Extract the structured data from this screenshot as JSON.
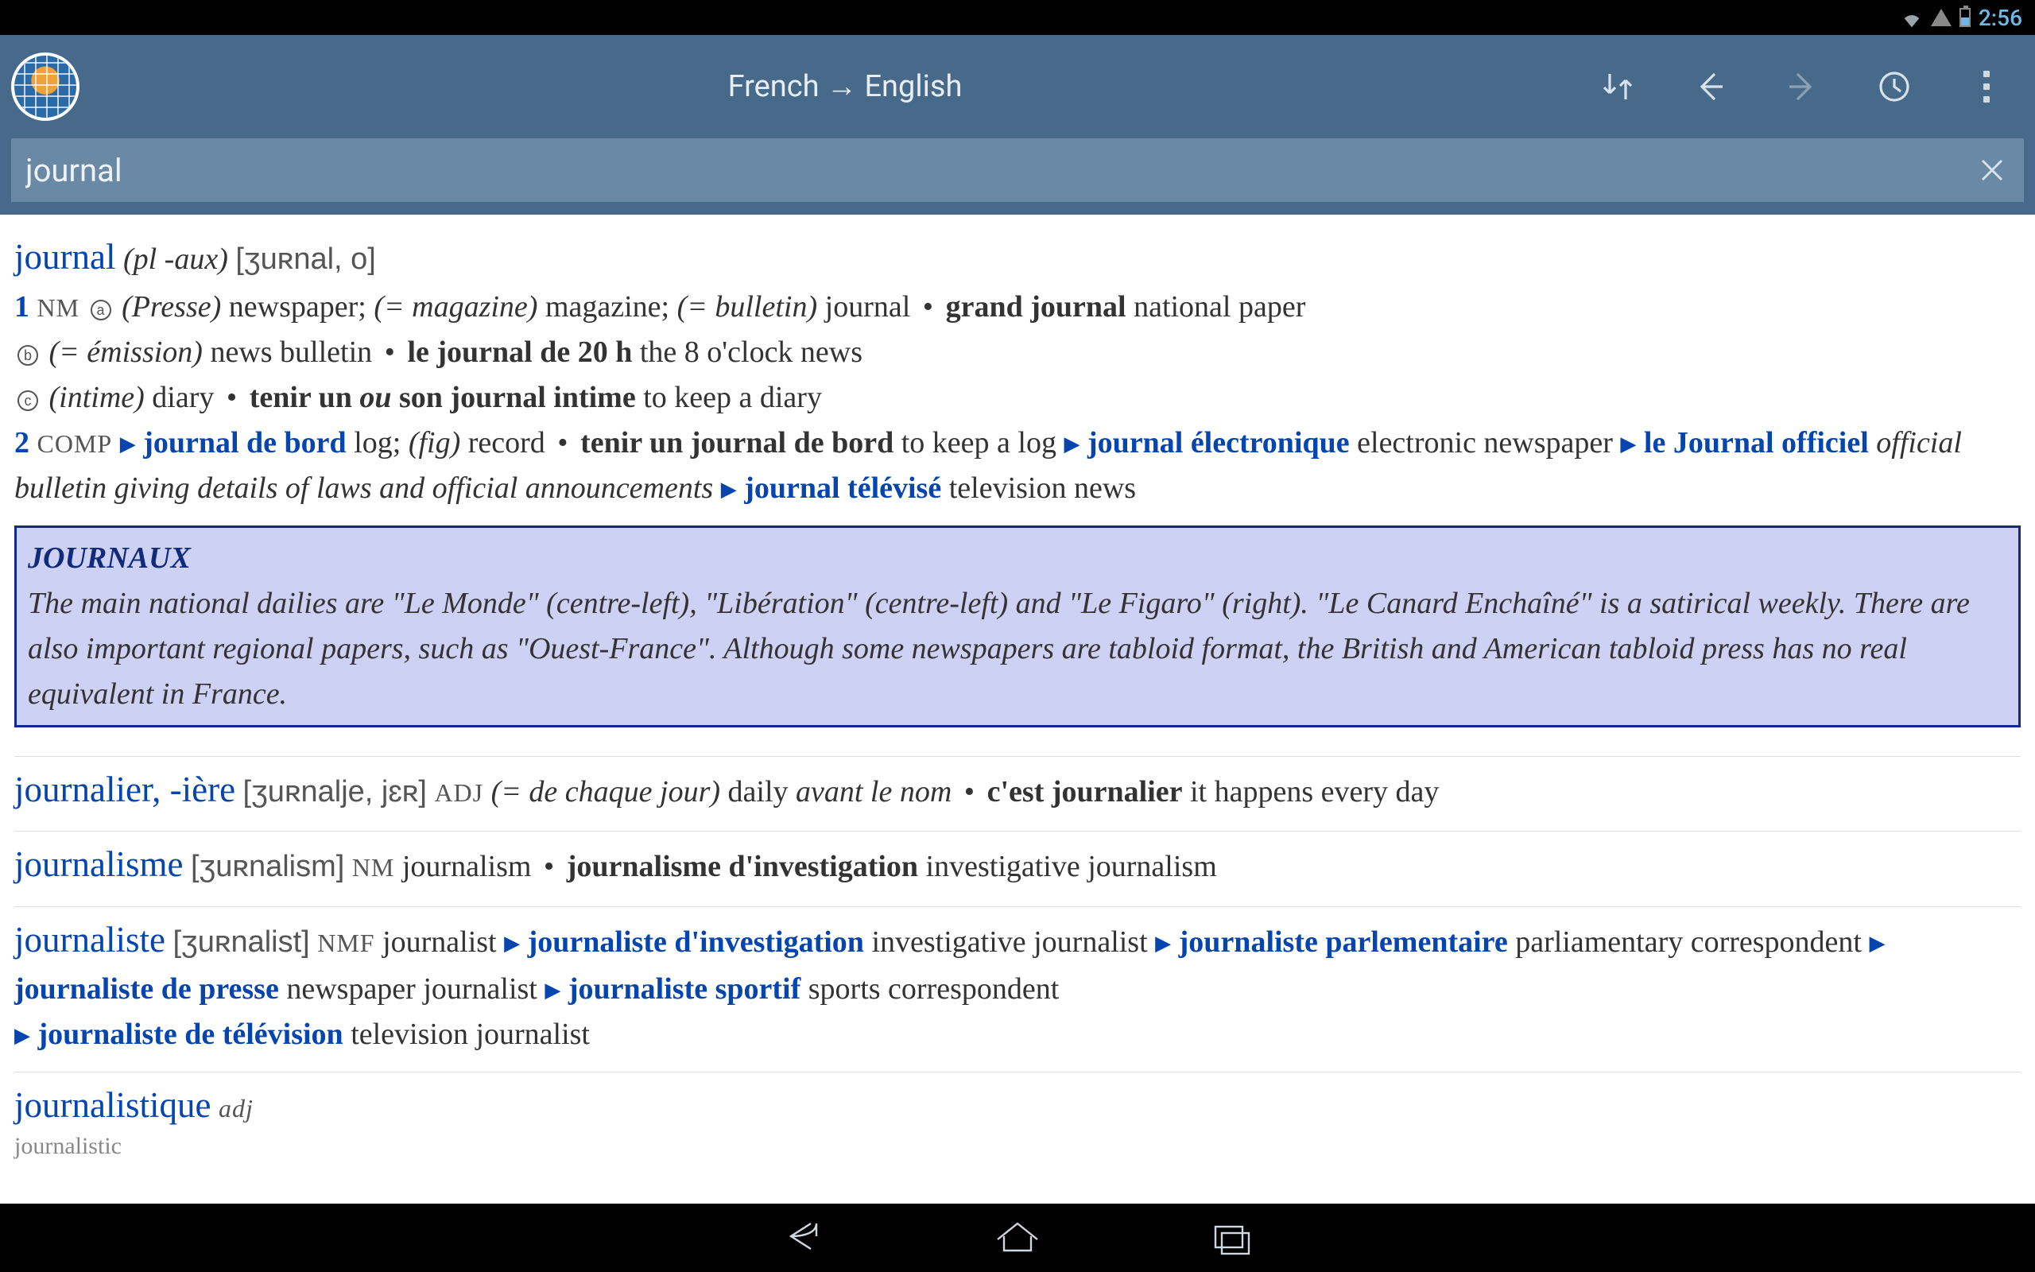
{
  "status": {
    "time": "2:56"
  },
  "header": {
    "title": "French  →  English"
  },
  "search": {
    "value": "journal"
  },
  "entries": {
    "journal": {
      "hw": "journal",
      "inflect": "(pl -aux)",
      "ipa": "[ʒuʀnal, o]",
      "sense1_num": "1",
      "sense1_pos": "NM",
      "s1a_ctx": "(Presse)",
      "s1a_tr": "newspaper; ",
      "s1a_eqmag": "(= magazine)",
      "s1a_mag": " magazine; ",
      "s1a_eqbull": "(= bulletin)",
      "s1a_journal": " journal ",
      "s1a_grand_fr": "grand journal",
      "s1a_grand_en": " national paper",
      "s1b_ctx": "(= émission)",
      "s1b_tr": " news bulletin ",
      "s1b_20h_fr": "le journal de 20 h",
      "s1b_20h_en": " the 8 o'clock news",
      "s1c_ctx": "(intime)",
      "s1c_tr": " diary ",
      "s1c_tenir_prefix": "tenir un ",
      "s1c_tenir_ou": "ou",
      "s1c_tenir_suffix": " son journal intime",
      "s1c_tenir_en": " to keep a diary",
      "sense2_num": "2",
      "sense2_pos": "COMP",
      "s2_bord_fr": "journal de bord",
      "s2_bord_en": " log; ",
      "s2_fig": "(fig)",
      "s2_record": " record ",
      "s2_tenir_fr": "tenir un journal de bord",
      "s2_tenir_en": " to keep a log ",
      "s2_elec_fr": "journal électronique",
      "s2_elec_en": " electronic newspaper ",
      "s2_jo_fr": "le Journal officiel",
      "s2_jo_en": " official bulletin giving details of laws and official announcements ",
      "s2_tv_fr": "journal télévisé",
      "s2_tv_en": " television news"
    },
    "box": {
      "title": "JOURNAUX",
      "body": "The main national dailies are \"Le Monde\" (centre-left), \"Libération\" (centre-left) and \"Le Figaro\" (right). \"Le Canard Enchaîné\" is a satirical weekly. There are also important regional papers, such as \"Ouest-France\". Although some newspapers are tabloid format, the British and American tabloid press has no real equivalent in France."
    },
    "journalier": {
      "hw": "journalier",
      "suffix": ", -ière",
      "ipa": "[ʒuʀnalje, jɛʀ]",
      "pos": "ADJ",
      "ctx": "(= de chaque jour)",
      "tr": " daily ",
      "avant": "avant le nom",
      "ex_fr": "c'est journalier",
      "ex_en": " it happens every day"
    },
    "journalisme": {
      "hw": "journalisme",
      "ipa": "[ʒuʀnalism]",
      "pos": "NM",
      "tr": " journalism ",
      "inv_fr": "journalisme d'investigation",
      "inv_en": " investigative journalism"
    },
    "journaliste": {
      "hw": "journaliste",
      "ipa": "[ʒuʀnalist]",
      "pos": "NMF",
      "tr": " journalist ",
      "inv_fr": "journaliste d'investigation",
      "inv_en": " investigative journalist ",
      "parl_fr": "journaliste parlementaire",
      "parl_en": " parliamentary correspondent ",
      "presse_fr": "journaliste de presse",
      "presse_en": " newspaper journalist ",
      "sport_fr": "journaliste sportif",
      "sport_en": " sports correspondent ",
      "tv_fr": "journaliste de télévision",
      "tv_en": " television journalist"
    },
    "journalistique": {
      "hw": "journalistique",
      "pos": "adj",
      "cut": "journalistic"
    }
  }
}
